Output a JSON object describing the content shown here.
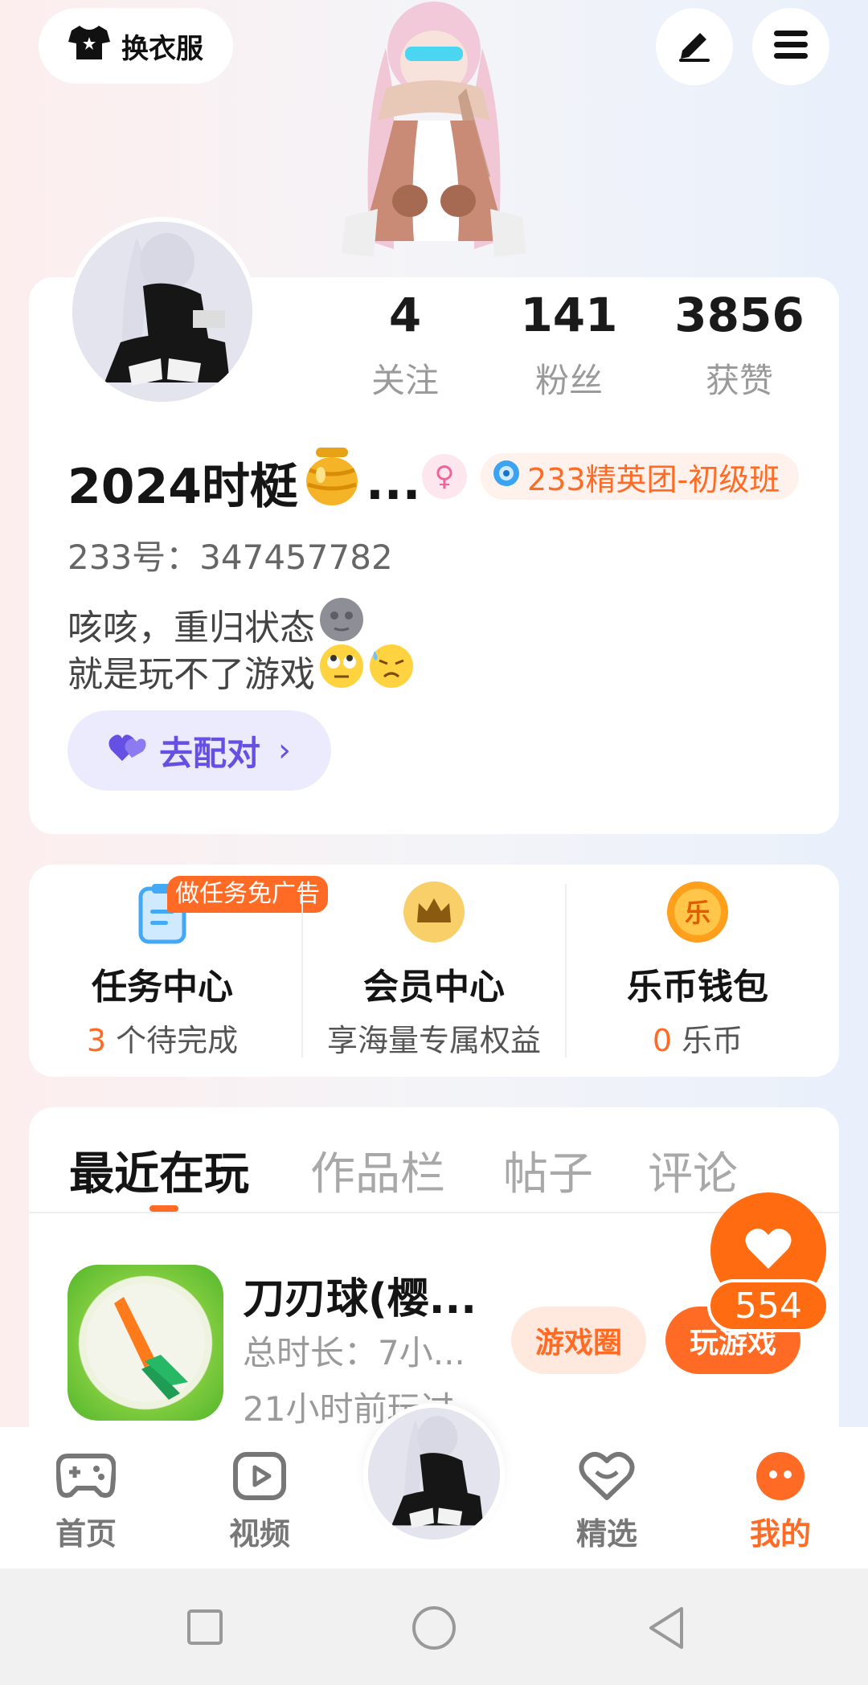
{
  "top_bar": {
    "dress_label": "换衣服"
  },
  "profile": {
    "stats": [
      {
        "value": "4",
        "label": "关注"
      },
      {
        "value": "141",
        "label": "粉丝"
      },
      {
        "value": "3856",
        "label": "获赞"
      }
    ],
    "nickname": "2024时梃",
    "nickname_ellipsis": "...",
    "gender_symbol": "♀",
    "level_badge": "233精英团-初级班",
    "uid": "233号：347457782",
    "bio_line1": "咳咳，重归状态",
    "bio_line2": "就是玩不了游戏",
    "match_button": "去配对",
    "match_chevron": "›"
  },
  "shortcuts": [
    {
      "title": "任务中心",
      "num": "3",
      "sub": " 个待完成",
      "tag": "做任务免广告"
    },
    {
      "title": "会员中心",
      "sub": "享海量专属权益"
    },
    {
      "title": "乐币钱包",
      "num": "0",
      "sub": " 乐币",
      "icon_text": "乐"
    }
  ],
  "tabs": [
    "最近在玩",
    "作品栏",
    "帖子",
    "评论"
  ],
  "recent_game": {
    "title": "刀刃球(樱...",
    "total_time": "总时长：7小...",
    "last_played": "21小时前玩过",
    "circle_button": "游戏圈",
    "play_button": "玩游戏"
  },
  "like": {
    "count": "554"
  },
  "bottom_nav": [
    {
      "label": "首页",
      "icon": "gamepad-icon"
    },
    {
      "label": "视频",
      "icon": "video-icon"
    },
    {
      "label": "精选",
      "icon": "heart-chat-icon"
    },
    {
      "label": "我的",
      "icon": "profile-dots-icon"
    }
  ],
  "colors": {
    "accent": "#ff6b24",
    "match_purple": "#6451e3"
  }
}
